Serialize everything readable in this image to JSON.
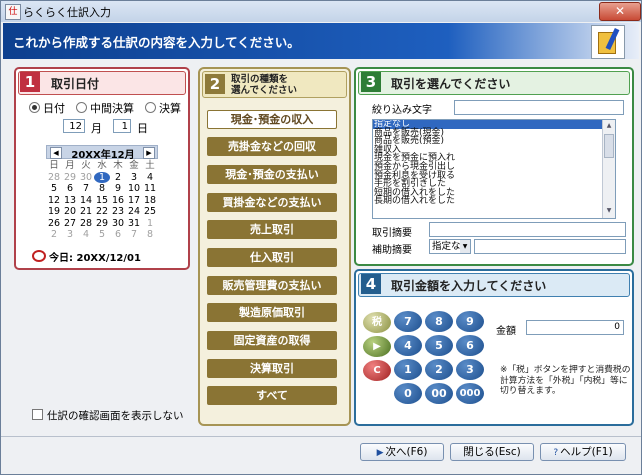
{
  "window": {
    "title": "らくらく仕訳入力",
    "close_label": "✕"
  },
  "banner": {
    "text": "これから作成する仕訳の内容を入力してください。"
  },
  "panel1": {
    "number": "1",
    "title": "取引日付",
    "radios": [
      {
        "label": "日付",
        "checked": true
      },
      {
        "label": "中間決算",
        "checked": false
      },
      {
        "label": "決算",
        "checked": false
      }
    ],
    "month_value": "12",
    "month_label": "月",
    "day_value": "1",
    "day_label": "日",
    "calendar": {
      "title": "20XX年12月",
      "weekdays": [
        "日",
        "月",
        "火",
        "水",
        "木",
        "金",
        "土"
      ],
      "rows": [
        [
          "28",
          "29",
          "30",
          "1",
          "2",
          "3",
          "4"
        ],
        [
          "5",
          "6",
          "7",
          "8",
          "9",
          "10",
          "11"
        ],
        [
          "12",
          "13",
          "14",
          "15",
          "16",
          "17",
          "18"
        ],
        [
          "19",
          "20",
          "21",
          "22",
          "23",
          "24",
          "25"
        ],
        [
          "26",
          "27",
          "28",
          "29",
          "30",
          "31",
          "1"
        ],
        [
          "2",
          "3",
          "4",
          "5",
          "6",
          "7",
          "8"
        ]
      ]
    },
    "today_label": "今日: 20XX/12/01"
  },
  "panel2": {
    "number": "2",
    "title_line1": "取引の種類を",
    "title_line2": "選んでください",
    "buttons": [
      "現金･預金の収入",
      "売掛金などの回収",
      "現金･預金の支払い",
      "買掛金などの支払い",
      "売上取引",
      "仕入取引",
      "販売管理費の支払い",
      "製造原価取引",
      "固定資産の取得",
      "決算取引",
      "すべて"
    ]
  },
  "panel3": {
    "number": "3",
    "title": "取引を選んでください",
    "filter_label": "絞り込み文字",
    "list_items": [
      "指定なし",
      "商品を販売(現金)",
      "商品を販売(預金)",
      "雑収入",
      "現金を預金に預入れ",
      "預金から現金引出し",
      "預金利息を受け取る",
      "手形を割引きした",
      "短期の借入れをした",
      "長期の借入れをした"
    ],
    "summary_label": "取引摘要",
    "aux_label": "補助摘要",
    "aux_combo": "指定な"
  },
  "panel4": {
    "number": "4",
    "title": "取引金額を入力してください",
    "amount_label": "金額",
    "amount_value": "0",
    "keys": {
      "tax": "税",
      "arrow": "▶",
      "clear": "C",
      "k7": "7",
      "k8": "8",
      "k9": "9",
      "k4": "4",
      "k5": "5",
      "k6": "6",
      "k1": "1",
      "k2": "2",
      "k3": "3",
      "k0": "0",
      "k00": "00",
      "k000": "000"
    },
    "note": "※「税」ボタンを押すと消費税の計算方法を「外税」「内税」等に切り替えます。"
  },
  "checkbox_label": "仕訳の確認画面を表示しない",
  "footer": {
    "next_label": "次へ(F6)",
    "close_label": "閉じる(Esc)",
    "help_label": "ヘルプ(F1)"
  }
}
